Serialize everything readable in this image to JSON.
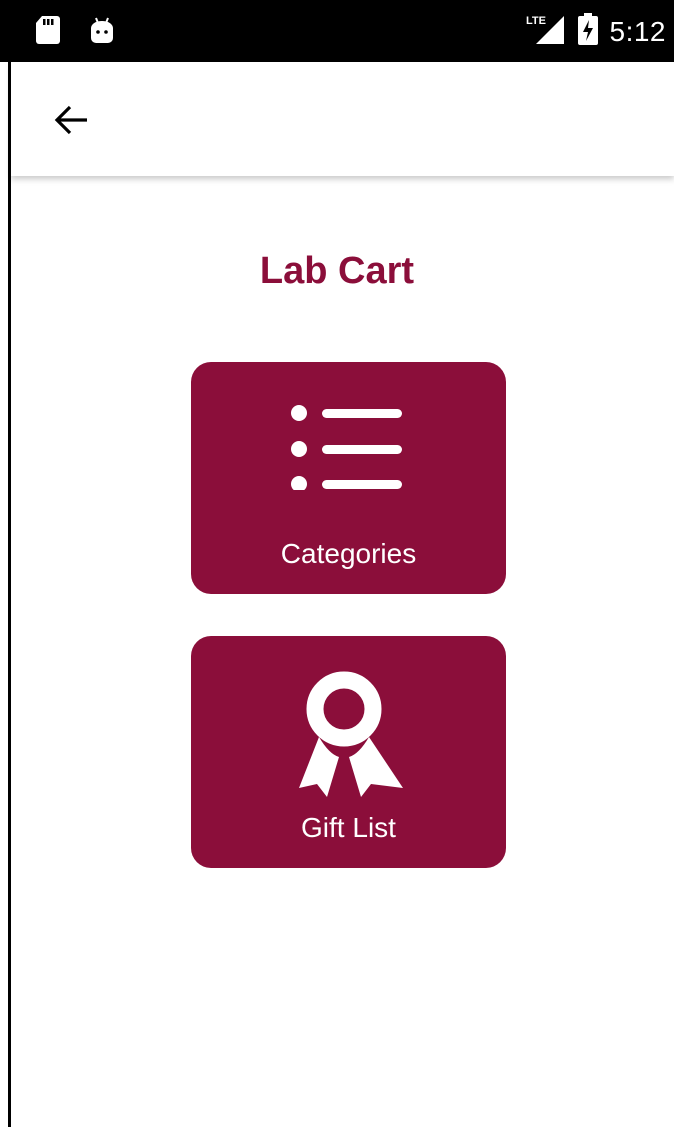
{
  "status_bar": {
    "time": "5:12",
    "network": "LTE",
    "left_icons": [
      "sd-card-icon",
      "android-debug-icon"
    ],
    "right_icons": [
      "lte-signal-icon",
      "battery-charging-icon"
    ]
  },
  "app_bar": {
    "back_icon": "arrow-left-icon"
  },
  "page": {
    "title": "Lab Cart"
  },
  "tiles": [
    {
      "label": "Categories",
      "icon": "list-icon"
    },
    {
      "label": "Gift List",
      "icon": "award-ribbon-icon"
    }
  ],
  "colors": {
    "accent": "#8b0e3a",
    "status_bar": "#000000",
    "background": "#ffffff",
    "tile_text": "#ffffff"
  }
}
